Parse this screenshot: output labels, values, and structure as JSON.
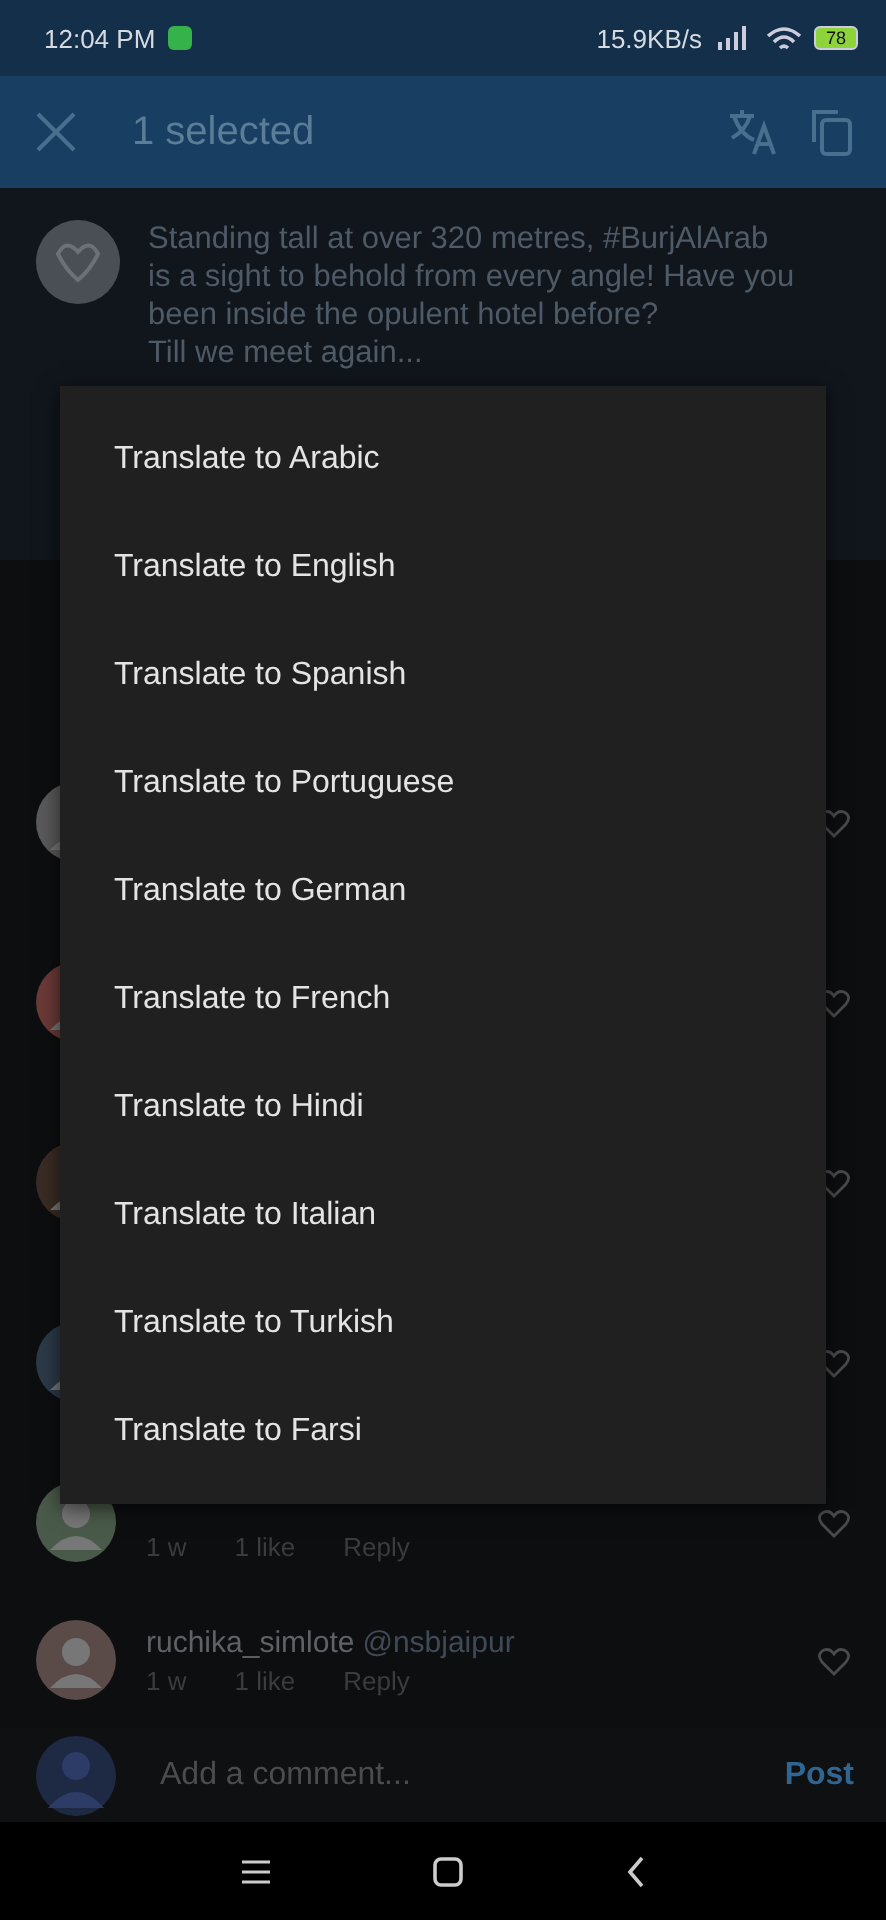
{
  "status_bar": {
    "time": "12:04 PM",
    "speed": "15.9KB/s",
    "battery": "78"
  },
  "app_bar": {
    "title": "1 selected"
  },
  "caption": {
    "lines": [
      "Standing tall at over 320 metres, #BurjAlArab",
      "is a sight to behold from every angle! Have you",
      "been inside the opulent hotel before?",
      "Till we meet again..."
    ]
  },
  "comments": [
    {
      "kind": "covered",
      "liked": false
    },
    {
      "kind": "covered",
      "liked": false
    },
    {
      "kind": "covered",
      "liked": false
    },
    {
      "kind": "covered",
      "liked": false
    },
    {
      "kind": "meta",
      "time": "1 w",
      "likes": "1 like",
      "reply": "Reply",
      "liked": false
    },
    {
      "kind": "full",
      "username": "ruchika_simlote",
      "mention": "@nsbjaipur",
      "time": "1 w",
      "likes": "1 like",
      "reply": "Reply",
      "liked": false
    }
  ],
  "comment_input": {
    "placeholder": "Add a comment...",
    "post": "Post"
  },
  "menu": {
    "items": [
      {
        "label": "Translate to Arabic"
      },
      {
        "label": "Translate to English"
      },
      {
        "label": "Translate to Spanish"
      },
      {
        "label": "Translate to Portuguese"
      },
      {
        "label": "Translate to German"
      },
      {
        "label": "Translate to French"
      },
      {
        "label": "Translate to Hindi"
      },
      {
        "label": "Translate to Italian"
      },
      {
        "label": "Translate to Turkish"
      },
      {
        "label": "Translate to Farsi"
      }
    ]
  }
}
